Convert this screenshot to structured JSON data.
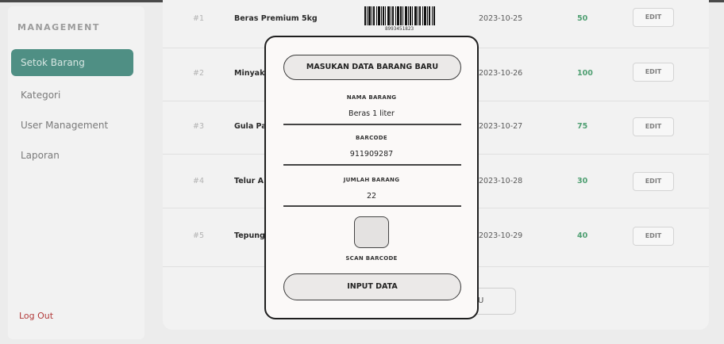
{
  "sidebar": {
    "brand": "MANAGEMENT",
    "items": [
      {
        "label": "Setok Barang",
        "active": true
      },
      {
        "label": "Kategori",
        "active": false
      },
      {
        "label": "User Management",
        "active": false
      },
      {
        "label": "Laporan",
        "active": false
      }
    ],
    "logout_label": "Log Out"
  },
  "table": {
    "rows": [
      {
        "no": "#1",
        "name": "Beras Premium 5kg",
        "date": "2023-10-25",
        "qty": "50",
        "edit": "EDIT"
      },
      {
        "no": "#2",
        "name": "Minyak",
        "date": "2023-10-26",
        "qty": "100",
        "edit": "EDIT"
      },
      {
        "no": "#3",
        "name": "Gula Pa",
        "date": "2023-10-27",
        "qty": "75",
        "edit": "EDIT"
      },
      {
        "no": "#4",
        "name": "Telur A",
        "date": "2023-10-28",
        "qty": "30",
        "edit": "EDIT"
      },
      {
        "no": "#5",
        "name": "Tepung",
        "date": "2023-10-29",
        "qty": "40",
        "edit": "EDIT"
      }
    ],
    "barcode_number": "8993451823"
  },
  "behind_button_text": "U",
  "modal": {
    "title": "MASUKAN DATA BARANG BARU",
    "fields": [
      {
        "label": "NAMA BARANG",
        "value": "Beras 1 liter"
      },
      {
        "label": "BARCODE",
        "value": "911909287"
      },
      {
        "label": "JUMLAH BARANG",
        "value": "22"
      }
    ],
    "scan_label": "SCAN BARCODE",
    "submit_label": "INPUT DATA"
  },
  "colors": {
    "accent": "#4f8f84",
    "qty_green": "#4f9f72",
    "logout_red": "#b23a3a"
  }
}
